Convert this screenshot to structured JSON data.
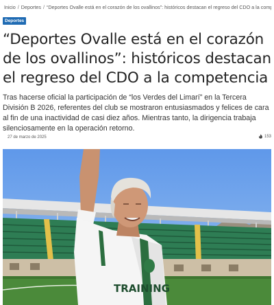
{
  "breadcrumb": {
    "home": "Inicio",
    "section": "Deportes",
    "current": "“Deportes Ovalle está en el corazón de los ovallinos”: históricos destacan el regreso del CDO a la competencia"
  },
  "category_badge": "Deportes",
  "headline": "“Deportes Ovalle está en el corazón de los ovallinos”: históricos destacan el regreso del CDO a la competencia",
  "lead": "Tras hacerse oficial la participación de “los Verdes del Limarí” en la Tercera División B 2026, referentes del club se mostraron entusiasmados y felices de cara al fin de una inactividad de casi diez años. Mientras tanto, la dirigencia trabaja silenciosamente en la operación retorno.",
  "meta": {
    "date": "27 de marzo de 2025",
    "comments": "153"
  },
  "hero_image": {
    "shirt_text": "TRAINING",
    "accent_color": "#1f6bb3"
  }
}
